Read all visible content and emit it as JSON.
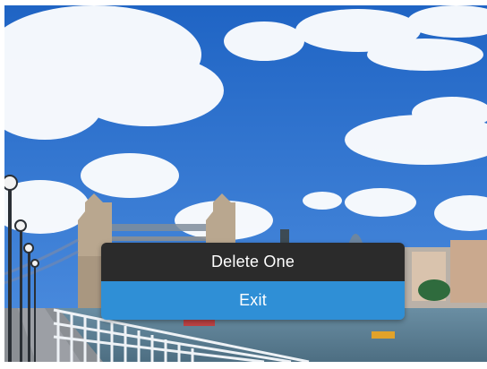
{
  "background": {
    "description_icon": "photo-preview-icon",
    "colors": {
      "sky_top": "#1f64c4",
      "sky_bottom": "#4f8fe0",
      "water": "#5f7f93",
      "walkway": "#8b8f94",
      "bridge": "#b9a78f",
      "railing": "#eef2f6"
    }
  },
  "menu": {
    "items": [
      {
        "label": "Delete One",
        "bg": "#2b2b2b"
      },
      {
        "label": "Exit",
        "bg": "#2f8fd6"
      }
    ]
  }
}
